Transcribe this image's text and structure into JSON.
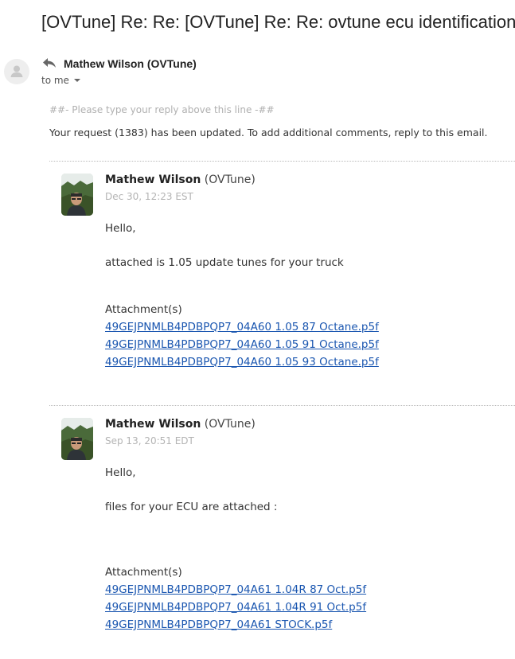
{
  "subject": "[OVTune] Re: Re: [OVTune] Re: Re: ovtune ecu identification",
  "header": {
    "sender": "Mathew Wilson (OVTune)",
    "to_label": "to me"
  },
  "reply_hint": "##- Please type your reply above this line -##",
  "request_note": "Your request (1383) has been updated. To add additional comments, reply to this email.",
  "messages": [
    {
      "author_name": "Mathew Wilson",
      "author_org": "(OVTune)",
      "date": "Dec 30, 12:23 EST",
      "greeting": "Hello,",
      "body": "attached is 1.05 update tunes for your truck",
      "attachments_label": "Attachment(s)",
      "attachments": [
        "49GEJPNMLB4PDBPQP7_04A60 1.05 87 Octane.p5f",
        "49GEJPNMLB4PDBPQP7_04A60 1.05 91 Octane.p5f",
        "49GEJPNMLB4PDBPQP7_04A60 1.05 93 Octane.p5f"
      ]
    },
    {
      "author_name": "Mathew Wilson",
      "author_org": "(OVTune)",
      "date": "Sep 13, 20:51 EDT",
      "greeting": "Hello,",
      "body": "files for your ECU are attached :",
      "attachments_label": "Attachment(s)",
      "attachments": [
        "49GEJPNMLB4PDBPQP7_04A61 1.04R 87 Oct.p5f",
        "49GEJPNMLB4PDBPQP7_04A61 1.04R 91 Oct.p5f",
        "49GEJPNMLB4PDBPQP7_04A61 STOCK.p5f"
      ]
    }
  ],
  "colors": {
    "link": "#1a56b0",
    "muted": "#b4b4b4"
  },
  "icons": {
    "reply": "reply-arrow-icon",
    "avatar": "default-person-icon"
  }
}
